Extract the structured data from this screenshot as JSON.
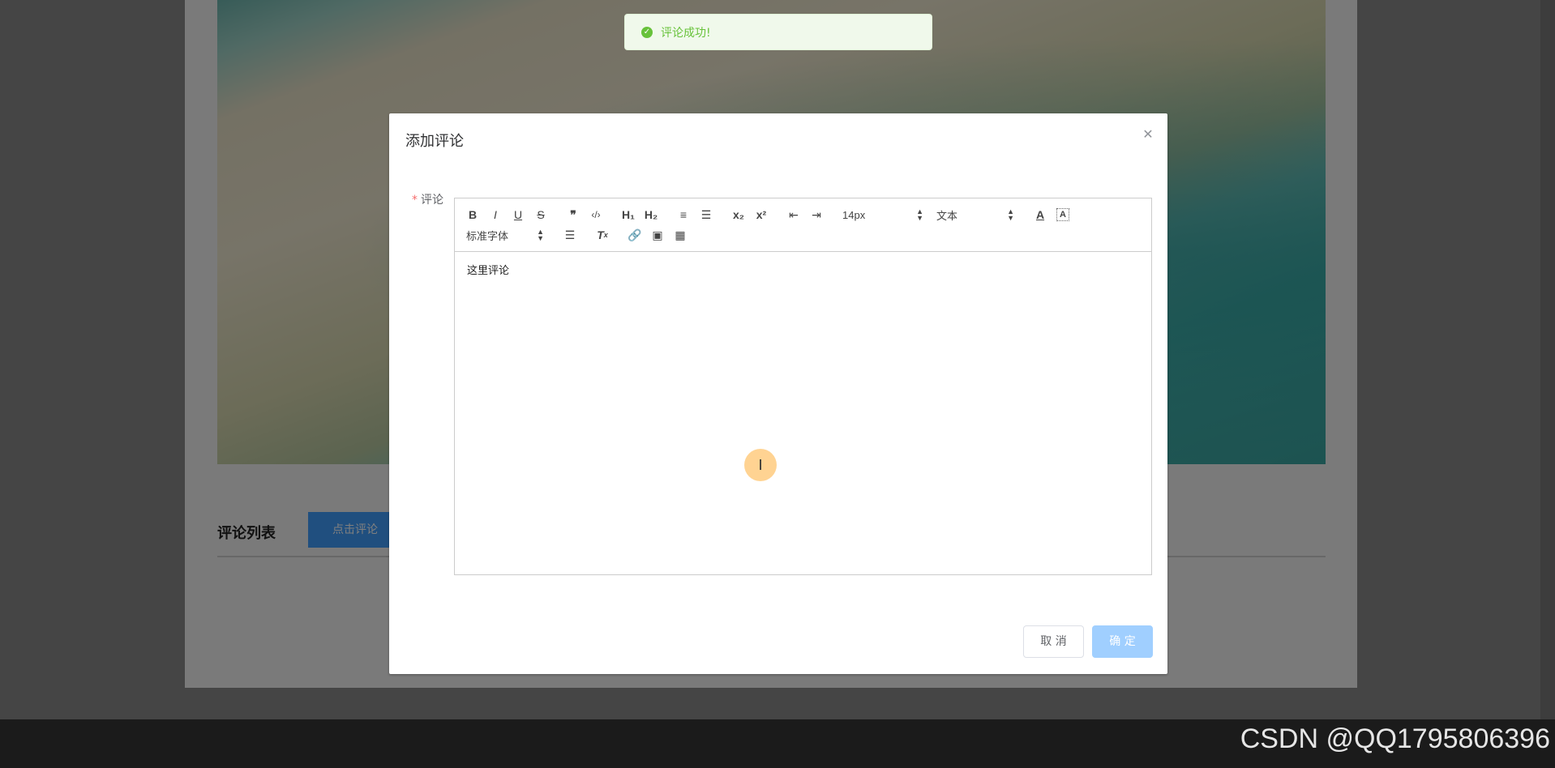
{
  "page": {
    "comments_title": "评论列表",
    "comment_button": "点击评论"
  },
  "toast": {
    "message": "评论成功!"
  },
  "dialog": {
    "title": "添加评论",
    "field_label": "评论",
    "required_mark": "*",
    "toolbar": {
      "row1": [
        {
          "name": "bold-button",
          "label": "B"
        },
        {
          "name": "italic-button",
          "label": "I"
        },
        {
          "name": "underline-button",
          "label": "U"
        },
        {
          "name": "strike-button",
          "label": "S"
        },
        {
          "name": "blockquote-button",
          "label": "❞"
        },
        {
          "name": "code-block-button",
          "label": "‹/›"
        },
        {
          "name": "h1-button",
          "label": "H₁"
        },
        {
          "name": "h2-button",
          "label": "H₂"
        },
        {
          "name": "ordered-list-button",
          "label": "≡"
        },
        {
          "name": "bullet-list-button",
          "label": "☰"
        },
        {
          "name": "subscript-button",
          "label": "x₂"
        },
        {
          "name": "superscript-button",
          "label": "x²"
        },
        {
          "name": "outdent-button",
          "label": "⇤"
        },
        {
          "name": "indent-button",
          "label": "⇥"
        }
      ],
      "size_select": "14px",
      "header_select": "文本",
      "font_select": "标准字体",
      "color_label": "A",
      "background_label": "A"
    },
    "content": "这里评论",
    "cancel_label": "取 消",
    "ok_label": "确 定"
  },
  "watermark": "CSDN @QQ1795806396",
  "colors": {
    "primary": "#409eff",
    "success": "#67c23a",
    "ok_disabled": "#a0cfff"
  }
}
